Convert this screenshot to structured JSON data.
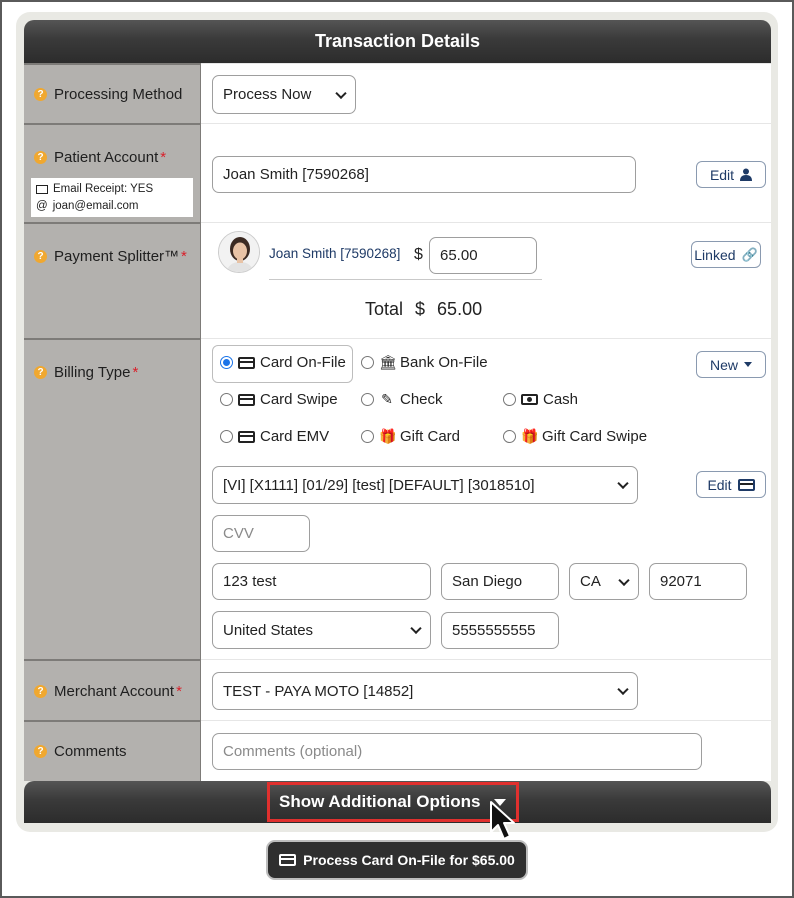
{
  "header": {
    "title": "Transaction Details"
  },
  "processing_method": {
    "label": "Processing Method",
    "value": "Process Now"
  },
  "patient_account": {
    "label": "Patient Account",
    "required_mark": "*",
    "value": "Joan Smith [7590268]",
    "edit_label": "Edit",
    "email_receipt": "Email Receipt: YES",
    "email_at": "@",
    "email": "joan@email.com"
  },
  "payment_splitter": {
    "label": "Payment Splitter™",
    "required_mark": "*",
    "patient_link": "Joan Smith [7590268]",
    "currency": "$",
    "amount": "65.00",
    "linked_label": "Linked",
    "total_label": "Total",
    "total_currency": "$",
    "total_value": "65.00"
  },
  "billing_type": {
    "label": "Billing Type",
    "required_mark": "*",
    "new_label": "New",
    "options": [
      {
        "label": "Card On-File",
        "icon": "credit-card-icon",
        "selected": true
      },
      {
        "label": "Bank On-File",
        "icon": "bank-icon",
        "selected": false
      },
      {
        "label": "Card Swipe",
        "icon": "credit-card-icon",
        "selected": false
      },
      {
        "label": "Check",
        "icon": "pencil-icon",
        "selected": false
      },
      {
        "label": "Cash",
        "icon": "money-icon",
        "selected": false
      },
      {
        "label": "Card EMV",
        "icon": "credit-card-icon",
        "selected": false
      },
      {
        "label": "Gift Card",
        "icon": "gift-icon",
        "selected": false
      },
      {
        "label": "Gift Card Swipe",
        "icon": "gift-icon",
        "selected": false
      }
    ],
    "card_value": "[VI] [X1111] [01/29] [test] [DEFAULT] [3018510]",
    "card_edit_label": "Edit",
    "cvv_placeholder": "CVV",
    "address": "123 test",
    "city": "San Diego",
    "state": "CA",
    "zip": "92071",
    "country": "United States",
    "phone": "5555555555"
  },
  "merchant_account": {
    "label": "Merchant Account",
    "required_mark": "*",
    "value": "TEST - PAYA MOTO [14852]"
  },
  "comments": {
    "label": "Comments",
    "placeholder": "Comments (optional)"
  },
  "footer": {
    "show_more_label": "Show Additional Options",
    "process_label": "Process Card On-File for $65.00"
  },
  "colors": {
    "accent": "#f0a830",
    "required": "#d9202b",
    "highlight": "#e0302e",
    "link": "#1e3a66"
  }
}
